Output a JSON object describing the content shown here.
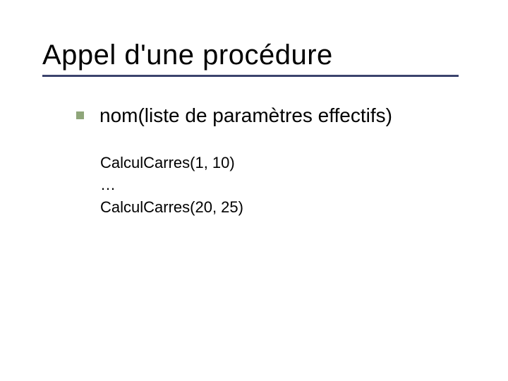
{
  "slide": {
    "title": "Appel d'une procédure",
    "bullet": "nom(liste de paramètres effectifs)",
    "code": {
      "line1": "CalculCarres(1, 10)",
      "line2": "…",
      "line3": "CalculCarres(20, 25)"
    }
  }
}
